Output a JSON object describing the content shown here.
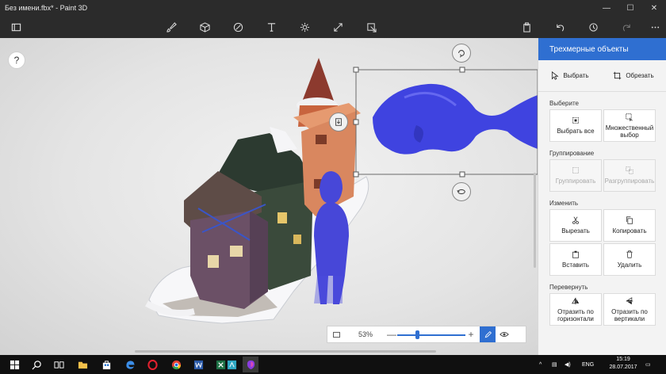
{
  "window": {
    "title": "Без имени.fbx* - Paint 3D",
    "controls": {
      "minimize": "—",
      "maximize": "☐",
      "close": "✕"
    }
  },
  "toolbar": {
    "left_icon": "menu-folder-icon",
    "tools": [
      "brushes-icon",
      "3d-objects-icon",
      "stickers-icon",
      "text-icon",
      "effects-icon",
      "canvas-icon",
      "remix3d-icon"
    ],
    "right_tools": [
      "paste-icon",
      "undo-icon",
      "history-icon",
      "redo-icon",
      "more-icon"
    ]
  },
  "canvas": {
    "help_label": "?"
  },
  "zoom": {
    "value": "53%",
    "minus": "—",
    "plus": "+",
    "level_fraction": 0.28
  },
  "panel": {
    "title": "Трехмерные объекты",
    "top_actions": {
      "select": "Выбрать",
      "crop": "Обрезать"
    },
    "sections": {
      "choose": {
        "title": "Выберите",
        "select_all": "Выбрать все",
        "multi_select": "Множественный выбор"
      },
      "group": {
        "title": "Группирование",
        "group": "Группировать",
        "ungroup": "Разгруппировать"
      },
      "edit": {
        "title": "Изменить",
        "cut": "Вырезать",
        "copy": "Копировать",
        "paste": "Вставить",
        "delete": "Удалить"
      },
      "flip": {
        "title": "Перевернуть",
        "flip_horizontal": "Отразить по горизонтали",
        "flip_vertical": "Отразить по вертикали"
      }
    }
  },
  "taskbar": {
    "apps": [
      "start-icon",
      "search-icon",
      "task-view-icon",
      "file-explorer-icon",
      "store-icon",
      "edge-icon",
      "cortana-icon",
      "opera-icon",
      "chrome-icon",
      "word-icon",
      "excel-icon",
      "paint3d-icon",
      "app-icon"
    ],
    "language": "ENG",
    "time": "15:19",
    "date": "28.07.2017"
  }
}
